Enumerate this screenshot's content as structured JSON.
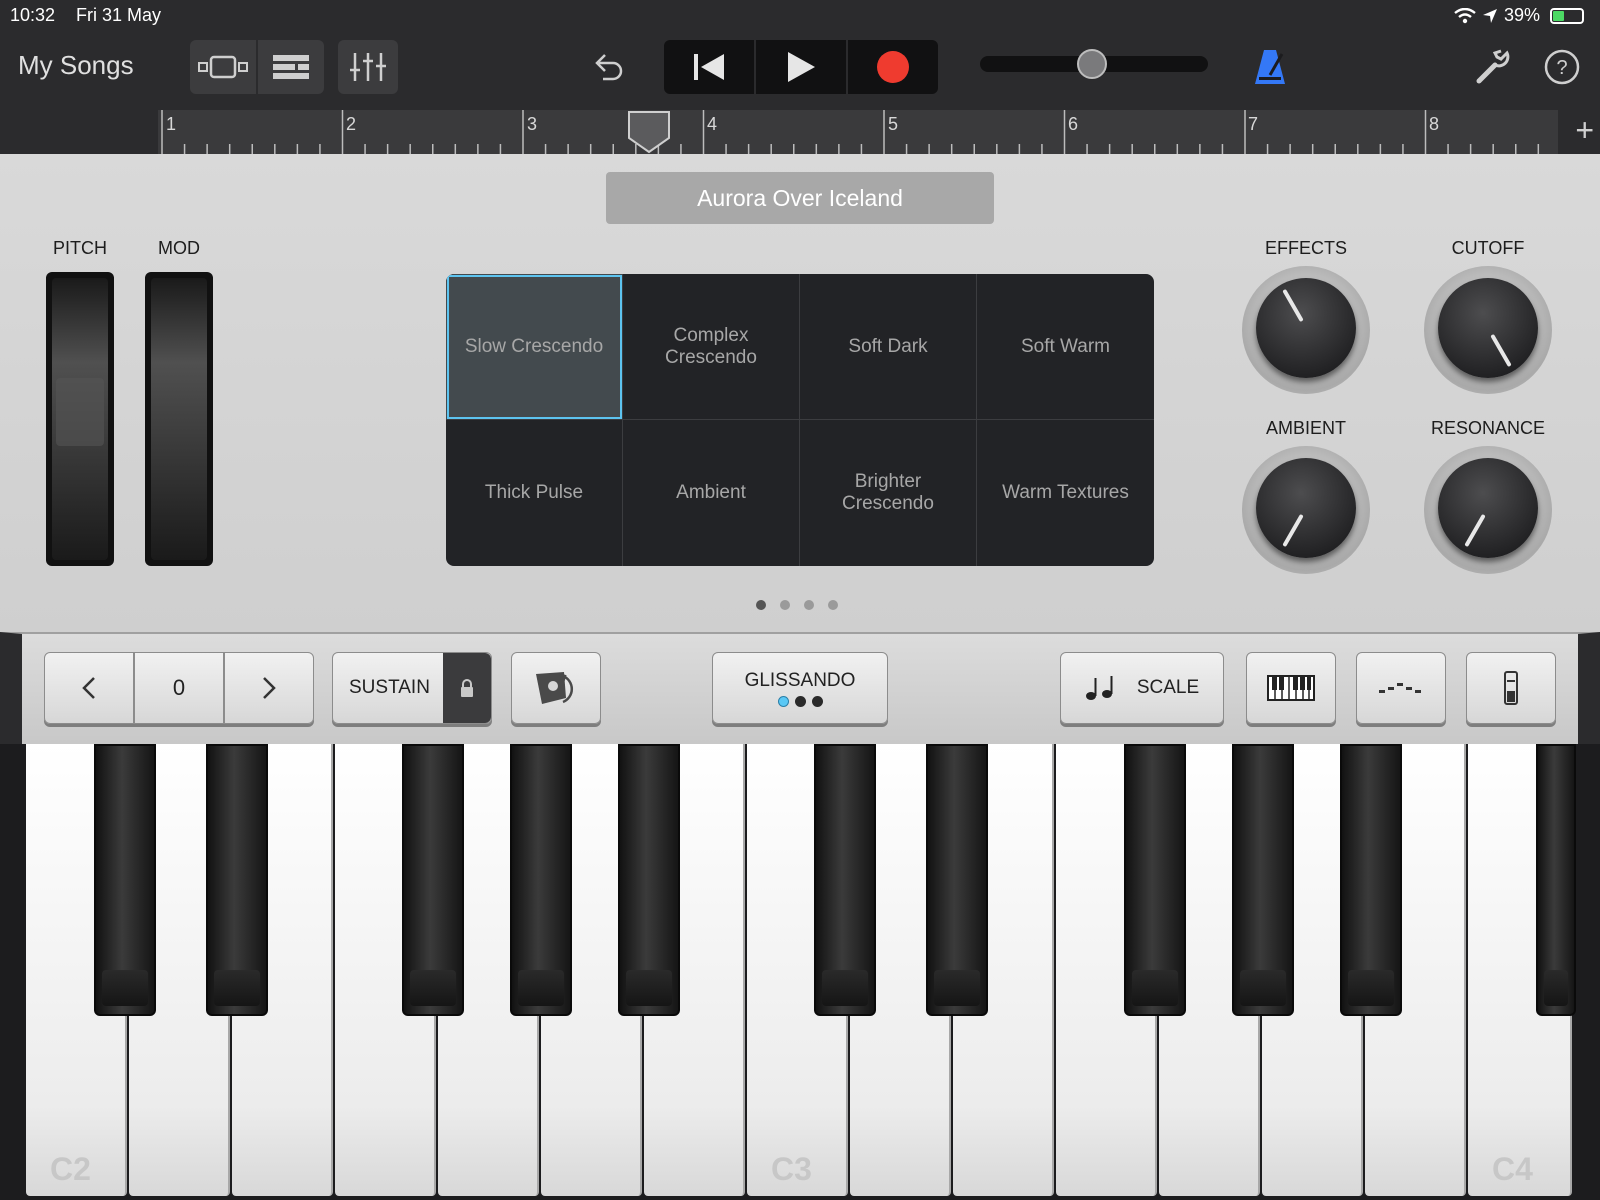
{
  "status_bar": {
    "time": "10:32",
    "date": "Fri 31 May",
    "battery": "39%",
    "battery_level": 0.39
  },
  "toolbar": {
    "my_songs": "My Songs",
    "icons": [
      "view-toggle-icon",
      "tracks-view-icon",
      "mixer-icon",
      "undo-icon",
      "rewind-icon",
      "play-icon",
      "record-icon",
      "metronome-icon",
      "settings-wrench-icon",
      "help-icon"
    ],
    "volume_level": 0.49,
    "metronome_color": "#3478f6",
    "record_color": "#ef3b2f"
  },
  "ruler": {
    "bars": [
      "1",
      "2",
      "3",
      "4",
      "5",
      "6",
      "7",
      "8"
    ],
    "playhead_bar": 3.7
  },
  "instrument": {
    "patch_name": "Aurora Over Iceland",
    "pitch_label": "PITCH",
    "mod_label": "MOD",
    "patches": [
      "Slow Crescendo",
      "Complex Crescendo",
      "Soft Dark",
      "Soft Warm",
      "Thick Pulse",
      "Ambient",
      "Brighter Crescendo",
      "Warm Textures"
    ],
    "selected_patch": 0,
    "knobs": [
      {
        "label": "EFFECTS",
        "angle": -30
      },
      {
        "label": "CUTOFF",
        "angle": 150
      },
      {
        "label": "AMBIENT",
        "angle": -150
      },
      {
        "label": "RESONANCE",
        "angle": -150
      }
    ],
    "pages": 4,
    "current_page": 1,
    "accent": "#5dc4f0"
  },
  "keyboard_controls": {
    "octave_value": "0",
    "sustain_label": "SUSTAIN",
    "glissando_label": "GLISSANDO",
    "scale_label": "SCALE"
  },
  "piano": {
    "octave_labels": [
      "C2",
      "C3",
      "C4"
    ]
  }
}
